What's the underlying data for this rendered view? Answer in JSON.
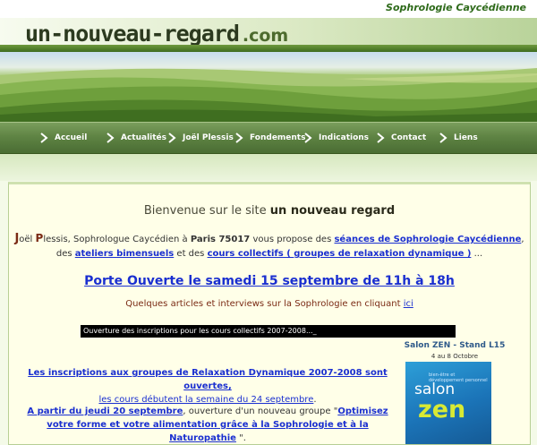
{
  "site": {
    "tagline": "Sophrologie Caycédienne",
    "logo_text": "un-nouveau-regard",
    "logo_tld": ".com"
  },
  "nav": {
    "items": [
      {
        "label": "Accueil"
      },
      {
        "label": "Actualités"
      },
      {
        "label": "Joël Plessis"
      },
      {
        "label": "Fondements"
      },
      {
        "label": "Indications"
      },
      {
        "label": "Contact"
      },
      {
        "label": "Liens"
      }
    ]
  },
  "content": {
    "welcome_prefix": "Bienvenue sur le site",
    "welcome_site": "un nouveau regard",
    "intro": {
      "name_j": "J",
      "name_rest1": "oël ",
      "name_p": "P",
      "name_rest2": "lessis, Sophrologue Caycédien à ",
      "city": "Paris 75017",
      "text1": " vous propose des  ",
      "link1": "séances de Sophrologie Caycédienne",
      "text2": ",",
      "text3": "des ",
      "link2": "ateliers bimensuels",
      "text4": " et des ",
      "link3": "cours collectifs ( groupes de relaxation dynamique )",
      "text5": " ..."
    },
    "porte_ouverte": "Porte Ouverte le samedi 15 septembre de 11h à 18h",
    "articles_text": "Quelques articles et interviews sur la Sophrologie en cliquant ",
    "articles_link": "ici",
    "ticker": "Ouverture des inscriptions pour les cours collectifs 2007-2008..._",
    "news1_line1": "Les inscriptions aux groupes de Relaxation Dynamique 2007-2008 sont ouvertes,",
    "news1_line2": "les cours débutent la semaine du 24 septembre",
    "news1_end": ".",
    "news2_link_a": "A partir du jeudi 20 septembre",
    "news2_text": ", ouverture d'un nouveau groupe \"",
    "news2_link_b": "Optimisez votre forme et votre alimentation grâce à la Sophrologie et à la Naturopathie",
    "news2_end": " \"."
  },
  "salon": {
    "title": "Salon ZEN - Stand L15",
    "dates": "4 au 8 Octobre",
    "sub": "bien-être et\ndéveloppement personnel",
    "word": "salon",
    "zen": "zen"
  },
  "colors": {
    "link": "#1a2fd0",
    "nav_bg": "#5f8444",
    "panel_bg": "#ffffe8"
  }
}
